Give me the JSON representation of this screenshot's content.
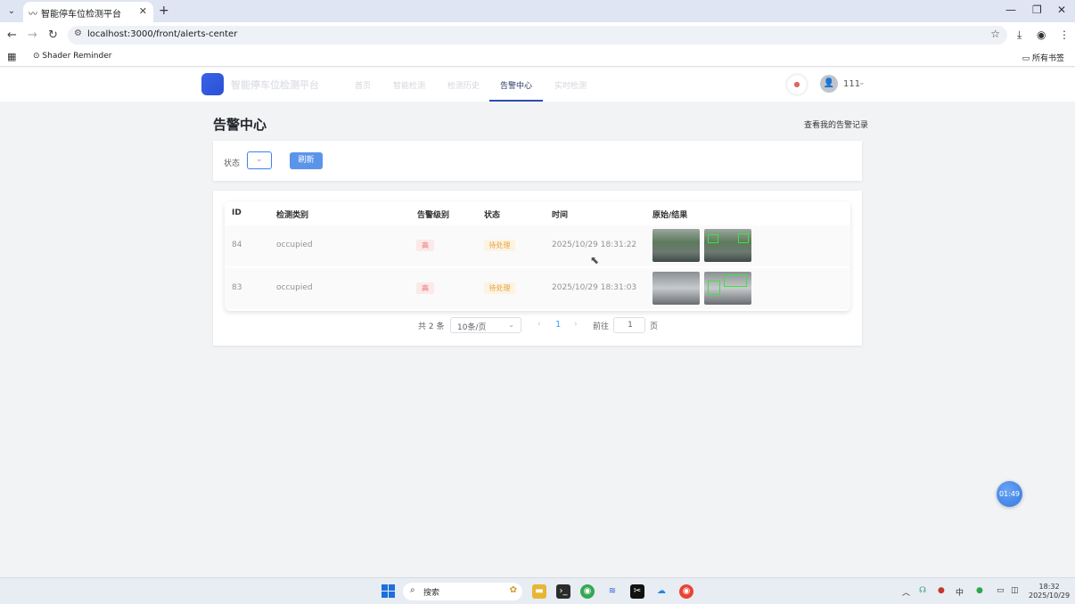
{
  "browser": {
    "tab_title": "智能停车位检测平台",
    "tab_close": "✕",
    "new_tab": "+",
    "url": "localhost:3000/front/alerts-center",
    "bookmark": "Shader Reminder",
    "bookmarks_folder": "所有书签"
  },
  "header": {
    "brand": "智能停车位检测平台",
    "nav": [
      "首页",
      "智能检测",
      "检测历史",
      "告警中心",
      "实时检测"
    ],
    "active_nav": "告警中心",
    "user": "111"
  },
  "page": {
    "title": "告警中心",
    "my_alerts_link": "查看我的告警记录",
    "filter_label": "状态",
    "refresh_label": "刷新"
  },
  "table": {
    "columns": [
      "ID",
      "检测类别",
      "告警级别",
      "状态",
      "时间",
      "原始/结果"
    ],
    "rows": [
      {
        "id": "84",
        "category": "occupied",
        "level": "高",
        "status": "待处理",
        "time": "2025/10/29 18:31:22"
      },
      {
        "id": "83",
        "category": "occupied",
        "level": "高",
        "status": "待处理",
        "time": "2025/10/29 18:31:03"
      }
    ]
  },
  "pagination": {
    "total": "共 2 条",
    "page_size": "10条/页",
    "current": "1",
    "goto_label": "前往",
    "goto_value": "1",
    "page_suffix": "页"
  },
  "timer": "01:49",
  "taskbar": {
    "search_text": "搜索",
    "ime": "中",
    "time": "18:32",
    "date": "2025/10/29"
  },
  "colors": {
    "primary": "#409eff",
    "refresh_button": "#5b95ea",
    "logo": "#2f55d4",
    "tag_high": "#e57373",
    "tag_pending": "#e6a23c"
  }
}
